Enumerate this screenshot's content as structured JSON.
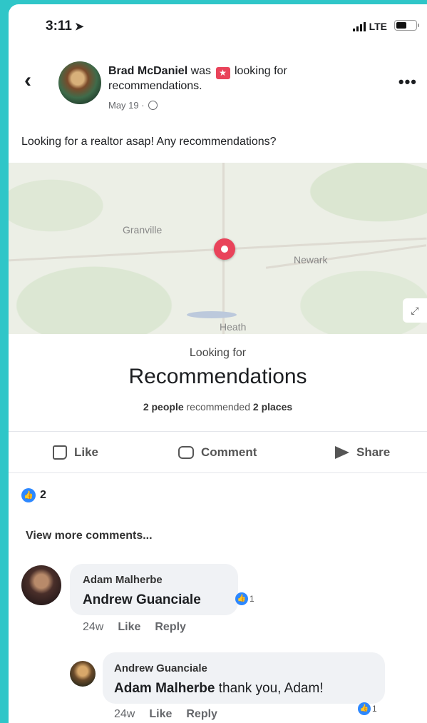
{
  "status_bar": {
    "time": "3:11",
    "network": "LTE"
  },
  "post": {
    "author": "Brad McDaniel",
    "action_before": "was",
    "action_after": "looking for recommendations.",
    "date": "May 19 ·",
    "text": "Looking for a realtor asap! Any recommendations?",
    "map": {
      "towns": [
        "Granville",
        "Newark",
        "Heath"
      ]
    },
    "recommendations": {
      "subtitle": "Looking for",
      "title": "Recommendations",
      "count_people": "2 people",
      "count_mid": "recommended",
      "count_places": "2 places"
    }
  },
  "actions": {
    "like": "Like",
    "comment": "Comment",
    "share": "Share"
  },
  "reactions": {
    "count": "2"
  },
  "comments": {
    "view_more": "View more comments...",
    "items": [
      {
        "author": "Adam Malherbe",
        "mention": "Andrew Guanciale",
        "text": "",
        "time": "24w",
        "like": "Like",
        "reply": "Reply",
        "reactions": "1"
      },
      {
        "author": "Andrew Guanciale",
        "mention": "Adam Malherbe",
        "text": "thank you, Adam!",
        "time": "24w",
        "like": "Like",
        "reply": "Reply",
        "reactions": "1"
      }
    ]
  },
  "colors": {
    "like_blue": "#2d88ff",
    "pin_red": "#e9435a",
    "frame": "#2fc6c8"
  }
}
